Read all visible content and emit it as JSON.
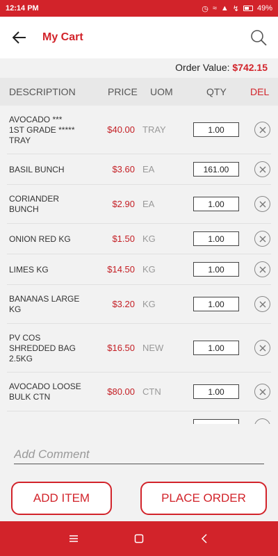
{
  "status_bar": {
    "time": "12:14 PM",
    "battery": "49%"
  },
  "app_bar": {
    "title": "My Cart"
  },
  "order": {
    "label": "Order Value: ",
    "value": "$742.15"
  },
  "table": {
    "columns": {
      "description": "DESCRIPTION",
      "price": "PRICE",
      "uom": "UOM",
      "qty": "QTY",
      "del": "DEL"
    },
    "rows": [
      {
        "description": "AVOCADO  ***\n1st GRADE *****\nTRAY",
        "price": "$40.00",
        "uom": "TRAY",
        "qty": "1.00"
      },
      {
        "description": "BASIL BUNCH",
        "price": "$3.60",
        "uom": "EA",
        "qty": "161.00"
      },
      {
        "description": "CORIANDER\nBUNCH",
        "price": "$2.90",
        "uom": "EA",
        "qty": "1.00"
      },
      {
        "description": "ONION RED KG",
        "price": "$1.50",
        "uom": "KG",
        "qty": "1.00"
      },
      {
        "description": "LIMES KG",
        "price": "$14.50",
        "uom": "KG",
        "qty": "1.00"
      },
      {
        "description": "BANANAS LARGE\nKG",
        "price": "$3.20",
        "uom": "KG",
        "qty": "1.00"
      },
      {
        "description": "PV COS\nSHREDDED BAG\n2.5KG",
        "price": "$16.50",
        "uom": "NEW",
        "qty": "1.00"
      },
      {
        "description": "AVOCADO  LOOSE\nBULK  CTN",
        "price": "$80.00",
        "uom": "CTN",
        "qty": "1.00"
      }
    ]
  },
  "comment": {
    "placeholder": "Add Comment",
    "value": ""
  },
  "buttons": {
    "add_item": "ADD ITEM",
    "place_order": "PLACE ORDER"
  },
  "colors": {
    "accent": "#d2232a",
    "price": "#c41e24",
    "header_bg": "#e8e8e8"
  },
  "icons": {
    "back": "arrow-left-icon",
    "search": "search-icon",
    "delete": "close-circle-icon",
    "nav_menu": "menu-icon",
    "nav_home": "square-home-icon",
    "nav_back": "chevron-left-icon"
  }
}
